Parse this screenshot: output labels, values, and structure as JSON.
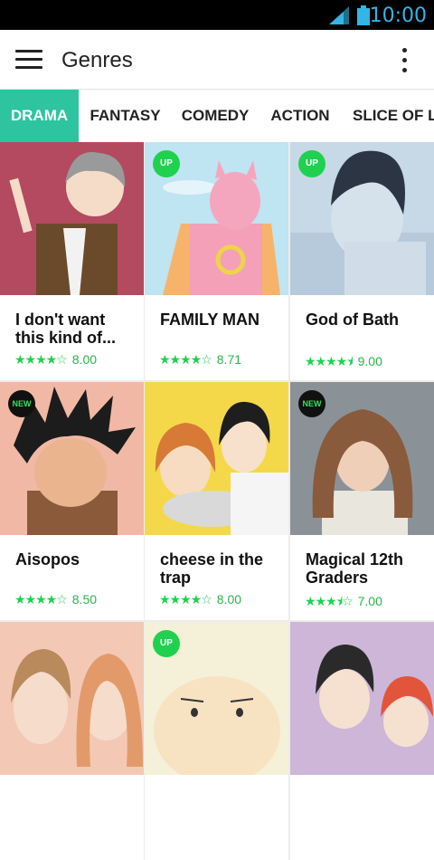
{
  "status": {
    "time": "10:00"
  },
  "appbar": {
    "title": "Genres"
  },
  "tabs": [
    {
      "label": "DRAMA"
    },
    {
      "label": "FANTASY"
    },
    {
      "label": "COMEDY"
    },
    {
      "label": "ACTION"
    },
    {
      "label": "SLICE OF LI"
    }
  ],
  "cards": [
    {
      "title": "I don't want this kind of...",
      "stars": "★★★★☆",
      "score": "8.00",
      "badge": ""
    },
    {
      "title": "FAMILY MAN",
      "stars": "★★★★☆",
      "score": "8.71",
      "badge": "UP"
    },
    {
      "title": "God of Bath",
      "stars": "★★★★⯨",
      "score": "9.00",
      "badge": "UP"
    },
    {
      "title": "Aisopos",
      "stars": "★★★★☆",
      "score": "8.50",
      "badge": "NEW"
    },
    {
      "title": "cheese in the trap",
      "stars": "★★★★☆",
      "score": "8.00",
      "badge": ""
    },
    {
      "title": "Magical 12th Graders",
      "stars": "★★★⯨☆",
      "score": "7.00",
      "badge": "NEW"
    },
    {
      "title": "",
      "stars": "",
      "score": "",
      "badge": ""
    },
    {
      "title": "",
      "stars": "",
      "score": "",
      "badge": "UP"
    },
    {
      "title": "",
      "stars": "",
      "score": "",
      "badge": ""
    }
  ],
  "colors": {
    "accent": "#2ec4a0",
    "star": "#1fd14f",
    "status_text": "#33b5e5"
  }
}
